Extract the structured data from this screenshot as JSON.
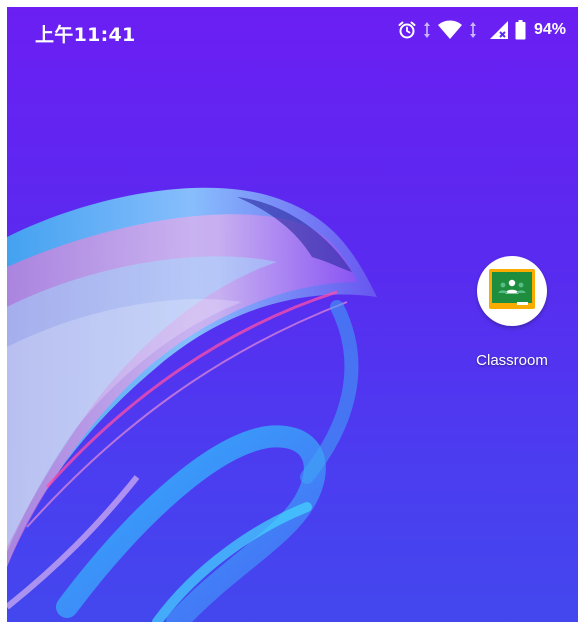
{
  "status_bar": {
    "time": "上午11:41",
    "battery_percent": "94%",
    "icons": [
      "alarm-icon",
      "data-activity-icon",
      "wifi-icon",
      "signal-icon",
      "battery-icon"
    ]
  },
  "home": {
    "apps": [
      {
        "label": "Classroom",
        "icon": "google-classroom-icon"
      }
    ]
  },
  "colors": {
    "wallpaper_top": "#6b1ff2",
    "wallpaper_bottom": "#4347ee",
    "classroom_green": "#1e8e3e",
    "classroom_yellow": "#f9ab00",
    "text": "#ffffff"
  }
}
